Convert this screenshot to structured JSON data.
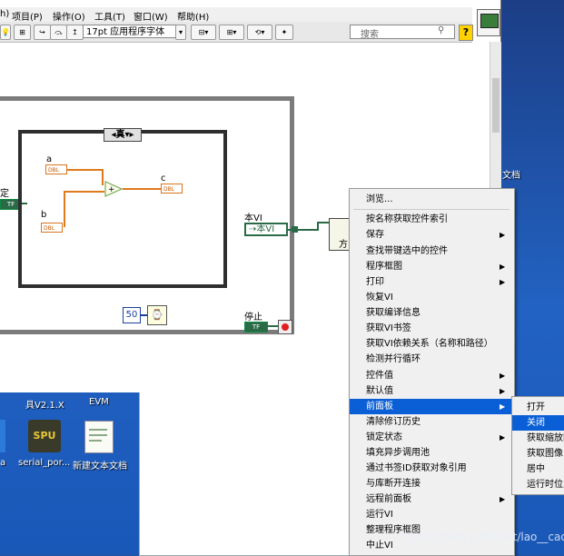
{
  "menubar": {
    "items": [
      "项目(P)",
      "操作(O)",
      "工具(T)",
      "窗口(W)",
      "帮助(H)"
    ],
    "first_partial": "h)"
  },
  "toolbar": {
    "font_select": "17pt 应用程序字体",
    "search_placeholder": "搜索",
    "help_label": "?"
  },
  "diagram": {
    "case_selector": "真",
    "control_a": "a",
    "control_b": "b",
    "indicator_c": "c",
    "dbl": "DBL",
    "this_vi_label": "本VI",
    "this_vi_ref": "本VI",
    "stop_label": "停止",
    "wait_const": "50",
    "partial_left_label": "定",
    "method_partial": "方",
    "tf": "TF"
  },
  "context_menu": {
    "items": [
      {
        "label": "浏览...",
        "arrow": false
      },
      {
        "label": "按名称获取控件索引",
        "arrow": false
      },
      {
        "label": "保存",
        "arrow": true
      },
      {
        "label": "查找带键选中的控件",
        "arrow": false
      },
      {
        "label": "程序框图",
        "arrow": true
      },
      {
        "label": "打印",
        "arrow": true
      },
      {
        "label": "恢复VI",
        "arrow": false
      },
      {
        "label": "获取编译信息",
        "arrow": false
      },
      {
        "label": "获取VI书签",
        "arrow": false
      },
      {
        "label": "获取VI依赖关系（名称和路径）",
        "arrow": false
      },
      {
        "label": "检测并行循环",
        "arrow": false
      },
      {
        "label": "控件值",
        "arrow": true
      },
      {
        "label": "默认值",
        "arrow": true
      },
      {
        "label": "前面板",
        "arrow": true,
        "highlighted": true
      },
      {
        "label": "清除修订历史",
        "arrow": false
      },
      {
        "label": "锁定状态",
        "arrow": true
      },
      {
        "label": "填充异步调用池",
        "arrow": false
      },
      {
        "label": "通过书签ID获取对象引用",
        "arrow": false
      },
      {
        "label": "与库断开连接",
        "arrow": false
      },
      {
        "label": "远程前面板",
        "arrow": true
      },
      {
        "label": "运行VI",
        "arrow": false
      },
      {
        "label": "整理程序框图",
        "arrow": false
      },
      {
        "label": "中止VI",
        "arrow": false
      }
    ],
    "arrow_glyph": "▶"
  },
  "submenu": {
    "items": [
      {
        "label": "打开"
      },
      {
        "label": "关闭",
        "highlighted": true
      },
      {
        "label": "获取缩放因子"
      },
      {
        "label": "获取图像"
      },
      {
        "label": "居中"
      },
      {
        "label": "运行时位置"
      }
    ]
  },
  "desktop": {
    "icon_labels": [
      "具V2.1.X",
      "EVM",
      "serial_por...",
      "新建文本文档"
    ],
    "left_partial_label": "a",
    "side_label": "文档",
    "spu_text": "SPU"
  },
  "watermark": "https://blog.csdn.net/lao__cao",
  "colors": {
    "highlight": "#0a5fd6",
    "wire_numeric": "#e07a1c",
    "wire_ref": "#2a6a46"
  }
}
